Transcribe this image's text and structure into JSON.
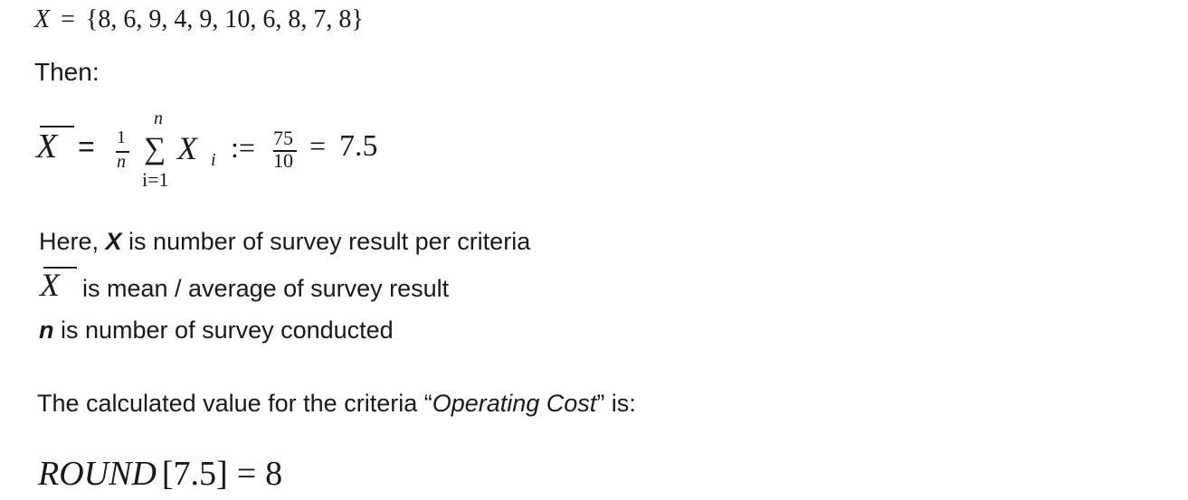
{
  "set_definition": {
    "variable": "X",
    "equals": "=",
    "values": "{8, 6, 9, 4, 9, 10, 6, 8, 7, 8}"
  },
  "then_label": "Then:",
  "mean_formula": {
    "lhs": "X",
    "equals": "=",
    "fraction_numerator": "1",
    "fraction_denominator": "n",
    "sum_upper": "n",
    "sum_symbol": "∑",
    "sum_lower": "i=1",
    "summand": "X",
    "summand_subscript": "i",
    "assign": ":=",
    "total_numerator": "75",
    "total_denominator": "10",
    "result_equals": "=",
    "result": "7.5"
  },
  "explanations": {
    "here_prefix": "Here, ",
    "x_symbol": "X",
    "x_desc": " is number of survey result per criteria",
    "xbar_symbol": "X",
    "xbar_desc": "is mean / average of survey result",
    "n_symbol": "n",
    "n_desc": " is number of survey conducted"
  },
  "calculated": {
    "prefix": "The calculated value for the criteria “",
    "criteria": "Operating Cost",
    "suffix": "” is:"
  },
  "round_result": {
    "func": "ROUND",
    "arg": "[7.5]",
    "equals": "=",
    "value": "8"
  }
}
